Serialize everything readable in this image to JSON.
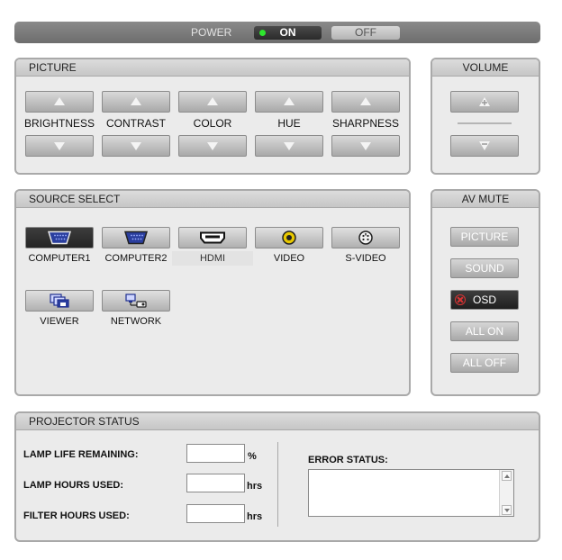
{
  "power": {
    "label": "POWER",
    "on_label": "ON",
    "off_label": "OFF",
    "state": "on",
    "indicator_color": "#2ee62e"
  },
  "picture": {
    "title": "PICTURE",
    "controls": [
      "BRIGHTNESS",
      "CONTRAST",
      "COLOR",
      "HUE",
      "SHARPNESS"
    ]
  },
  "volume": {
    "title": "VOLUME"
  },
  "source": {
    "title": "SOURCE SELECT",
    "items": [
      {
        "label": "COMPUTER1",
        "icon": "vga-connector-icon",
        "active": true
      },
      {
        "label": "COMPUTER2",
        "icon": "vga-connector-icon",
        "active": false
      },
      {
        "label": "HDMI",
        "icon": "hdmi-connector-icon",
        "active": false
      },
      {
        "label": "VIDEO",
        "icon": "rca-connector-icon",
        "active": false
      },
      {
        "label": "S-VIDEO",
        "icon": "svideo-connector-icon",
        "active": false
      },
      {
        "label": "VIEWER",
        "icon": "viewer-icon",
        "active": false
      },
      {
        "label": "NETWORK",
        "icon": "network-icon",
        "active": false
      }
    ]
  },
  "av_mute": {
    "title": "AV MUTE",
    "buttons": [
      "PICTURE",
      "SOUND",
      "OSD",
      "ALL ON",
      "ALL OFF"
    ],
    "active": "OSD"
  },
  "status": {
    "title": "PROJECTOR STATUS",
    "lamp_life_label": "LAMP LIFE REMAINING:",
    "lamp_life_value": "",
    "lamp_life_unit": "%",
    "lamp_hours_label": "LAMP HOURS USED:",
    "lamp_hours_value": "",
    "lamp_hours_unit": "hrs",
    "filter_hours_label": "FILTER HOURS USED:",
    "filter_hours_value": "",
    "filter_hours_unit": "hrs",
    "error_label": "ERROR STATUS:",
    "error_value": ""
  },
  "colors": {
    "panel_bg": "#ebebeb",
    "panel_border": "#a9a9a9",
    "active_button": "#2b2b2b",
    "osd_mark": "#dd3333"
  }
}
